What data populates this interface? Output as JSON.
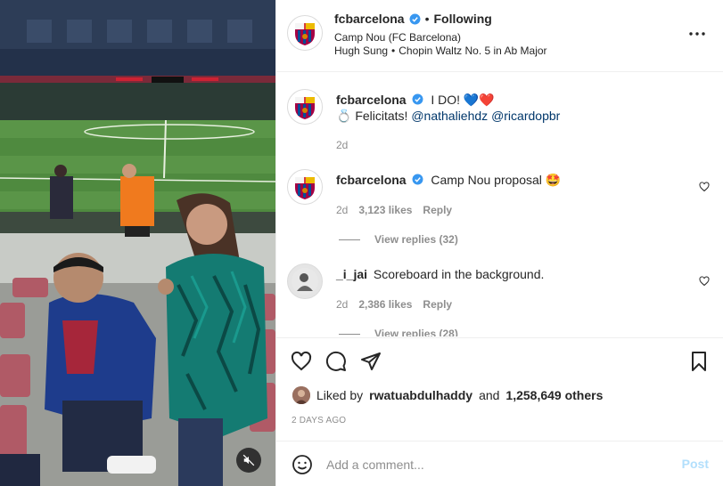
{
  "header": {
    "username": "fcbarcelona",
    "separator": "•",
    "follow_status": "Following",
    "location": "Camp Nou (FC Barcelona)",
    "audio_artist": "Hugh Sung",
    "audio_separator": "•",
    "audio_title": "Chopin Waltz No. 5 in Ab Major"
  },
  "caption": {
    "username": "fcbarcelona",
    "text": "I DO! 💙❤️",
    "line2_prefix": "💍 Felicitats!",
    "mention1": "@nathaliehdz",
    "mention2": "@ricardopbr",
    "time": "2d"
  },
  "comments": [
    {
      "username": "fcbarcelona",
      "text": "Camp Nou proposal 🤩",
      "time": "2d",
      "likes": "3,123 likes",
      "reply_label": "Reply",
      "view_replies": "View replies (32)"
    },
    {
      "username": "_i_jai",
      "text": "Scoreboard in the background.",
      "time": "2d",
      "likes": "2,386 likes",
      "reply_label": "Reply",
      "view_replies": "View replies (28)"
    }
  ],
  "likes": {
    "prefix": "Liked by",
    "user": "rwatuabdulhaddy",
    "conjunction": "and",
    "others": "1,258,649 others"
  },
  "posted_ago": "2 DAYS AGO",
  "add_comment": {
    "placeholder": "Add a comment...",
    "post_label": "Post"
  },
  "colors": {
    "verified_blue": "#3897f0",
    "post_disabled": "#b2dffc",
    "mention": "#00376b",
    "muted": "#8e8e8e"
  },
  "icons": {
    "mute": "speaker-muted-icon",
    "more": "more-horizontal-icon",
    "like": "heart-icon",
    "comment": "comment-icon",
    "share": "paper-plane-icon",
    "save": "bookmark-icon",
    "emoji": "smiley-icon"
  }
}
